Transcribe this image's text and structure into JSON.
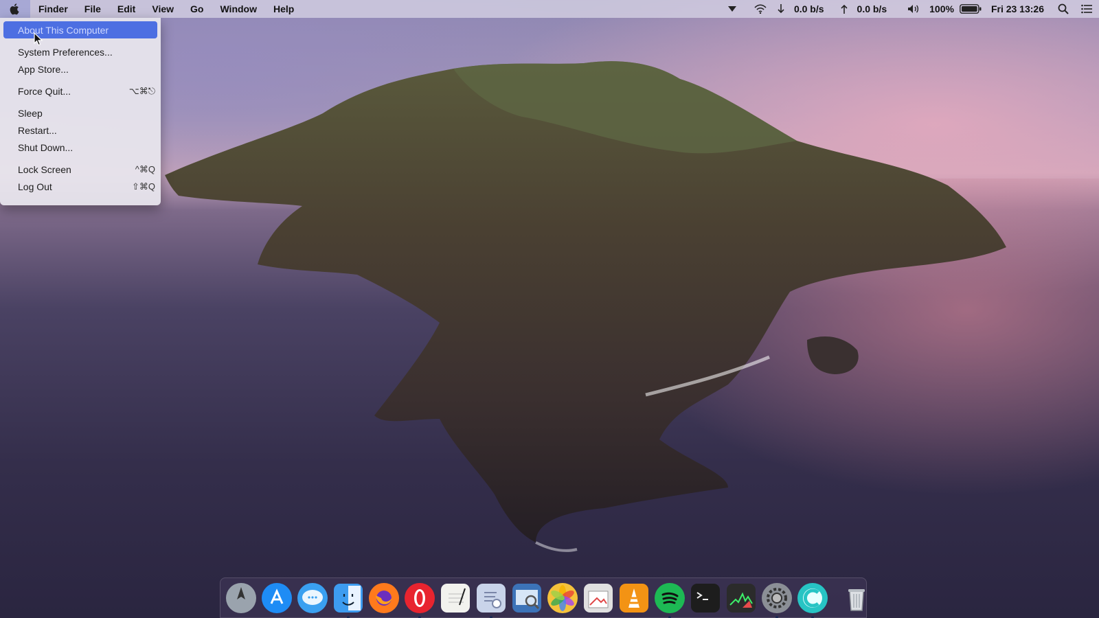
{
  "menubar": {
    "app_name": "Finder",
    "menus": [
      "File",
      "Edit",
      "View",
      "Go",
      "Window",
      "Help"
    ],
    "status": {
      "download_speed": "0.0 b/s",
      "upload_speed": "0.0 b/s",
      "battery_percent": "100%",
      "clock": "Fri 23 13:26"
    }
  },
  "apple_menu": {
    "items": [
      {
        "label": "About This Computer",
        "shortcut": ""
      },
      {
        "label": "System Preferences...",
        "shortcut": ""
      },
      {
        "label": "App Store...",
        "shortcut": ""
      },
      {
        "label": "Force Quit...",
        "shortcut": "⌥⌘⎋"
      },
      {
        "label": "Sleep",
        "shortcut": ""
      },
      {
        "label": "Restart...",
        "shortcut": ""
      },
      {
        "label": "Shut Down...",
        "shortcut": ""
      },
      {
        "label": "Lock Screen",
        "shortcut": "^⌘Q"
      },
      {
        "label": "Log Out",
        "shortcut": "⇧⌘Q"
      }
    ]
  },
  "dock": {
    "apps": [
      {
        "name": "launchpad-icon",
        "color": "#9aa3ad"
      },
      {
        "name": "app-store-icon",
        "color": "#1e8cf5"
      },
      {
        "name": "messages-icon",
        "color": "#3aa0f0"
      },
      {
        "name": "finder-icon",
        "color": "#3d9cf0"
      },
      {
        "name": "firefox-icon",
        "color": "#ff7a1c"
      },
      {
        "name": "opera-icon",
        "color": "#e8242f"
      },
      {
        "name": "textedit-icon",
        "color": "#f2f2ee"
      },
      {
        "name": "script-editor-icon",
        "color": "#c9d4ea"
      },
      {
        "name": "preview-icon",
        "color": "#3c73b8"
      },
      {
        "name": "photos-icon",
        "color": "#f5c23b"
      },
      {
        "name": "image-capture-icon",
        "color": "#e0e0e0"
      },
      {
        "name": "vlc-icon",
        "color": "#f39314"
      },
      {
        "name": "spotify-icon",
        "color": "#1db954"
      },
      {
        "name": "terminal-icon",
        "color": "#1d1d1d"
      },
      {
        "name": "activity-monitor-icon",
        "color": "#2b2b2b"
      },
      {
        "name": "system-preferences-icon",
        "color": "#8b8f96"
      },
      {
        "name": "cleaner-icon",
        "color": "#27c4c4"
      },
      {
        "name": "trash-icon",
        "color": "#c7cbd1"
      }
    ]
  }
}
